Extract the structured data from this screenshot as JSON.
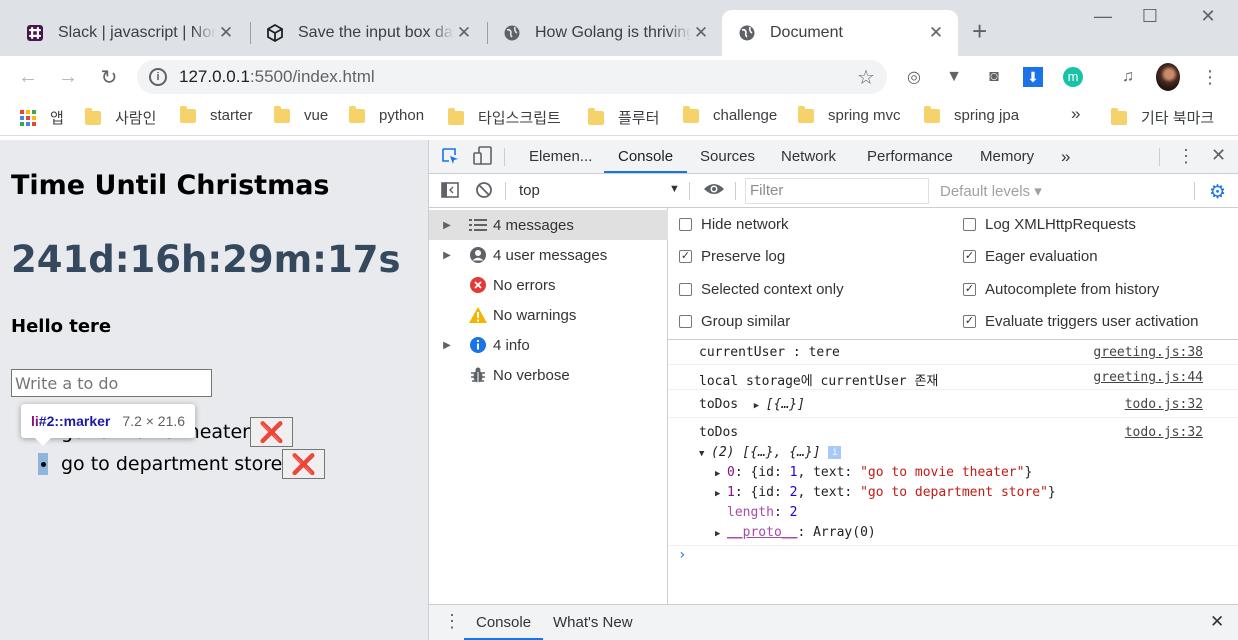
{
  "browser": {
    "tabs": [
      {
        "title": "Slack | javascript | Nom",
        "icon": "slack-icon"
      },
      {
        "title": "Save the input box data",
        "icon": "codesandbox-icon"
      },
      {
        "title": "How Golang is thriving",
        "icon": "globe-icon"
      },
      {
        "title": "Document",
        "icon": "globe-icon"
      }
    ],
    "url_host": "127.0.0.1",
    "url_path": ":5500/index.html",
    "bookmarks": [
      {
        "label": "앱",
        "icon": "apps-icon"
      },
      {
        "label": "사람인",
        "icon": "folder-icon"
      },
      {
        "label": "starter",
        "icon": "folder-icon"
      },
      {
        "label": "vue",
        "icon": "folder-icon"
      },
      {
        "label": "python",
        "icon": "folder-icon"
      },
      {
        "label": "타입스크립트",
        "icon": "folder-icon"
      },
      {
        "label": "플루터",
        "icon": "folder-icon"
      },
      {
        "label": "challenge",
        "icon": "folder-icon"
      },
      {
        "label": "spring mvc",
        "icon": "folder-icon"
      },
      {
        "label": "spring jpa",
        "icon": "folder-icon"
      }
    ],
    "bookmarks_overflow": "»",
    "other_bookmarks": "기타 북마크",
    "extension_badge": "m"
  },
  "page": {
    "title": "Time Until Christmas",
    "timer": "241d:16h:29m:17s",
    "greeting": "Hello tere",
    "todo_placeholder": "Write a to do",
    "todos": [
      {
        "text": "go to movie theater",
        "delete_label": "❌"
      },
      {
        "text": "go to department store",
        "delete_label": "❌"
      }
    ],
    "inspect_tooltip": {
      "selector_tag": "li",
      "selector_rest": "#2::marker",
      "dimensions": "7.2 × 21.6"
    }
  },
  "devtools": {
    "tabs": [
      "Elemen...",
      "Console",
      "Sources",
      "Network",
      "Performance",
      "Memory"
    ],
    "active_tab": "Console",
    "more_tabs": "»",
    "context": "top",
    "filter_placeholder": "Filter",
    "levels": "Default levels ▾",
    "sidebar": [
      {
        "label": "4 messages",
        "icon": "list-icon",
        "expandable": true,
        "selected": true
      },
      {
        "label": "4 user messages",
        "icon": "user-icon",
        "expandable": true,
        "selected": false
      },
      {
        "label": "No errors",
        "icon": "error-icon",
        "expandable": false,
        "selected": false
      },
      {
        "label": "No warnings",
        "icon": "warning-icon",
        "expandable": false,
        "selected": false
      },
      {
        "label": "4 info",
        "icon": "info-icon",
        "expandable": true,
        "selected": false
      },
      {
        "label": "No verbose",
        "icon": "bug-icon",
        "expandable": false,
        "selected": false
      }
    ],
    "settings": [
      {
        "label": "Hide network",
        "checked": false
      },
      {
        "label": "Log XMLHttpRequests",
        "checked": false
      },
      {
        "label": "Preserve log",
        "checked": true
      },
      {
        "label": "Eager evaluation",
        "checked": true
      },
      {
        "label": "Selected context only",
        "checked": false
      },
      {
        "label": "Autocomplete from history",
        "checked": true
      },
      {
        "label": "Group similar",
        "checked": false
      },
      {
        "label": "Evaluate triggers user activation",
        "checked": true
      }
    ],
    "console": {
      "logs": [
        {
          "text": "currentUser :  tere",
          "source": "greeting.js:38"
        },
        {
          "text": "local storage에 currentUser 존재",
          "source": "greeting.js:44"
        },
        {
          "label": "toDos",
          "preview": "[{…}]",
          "source": "todo.js:32"
        },
        {
          "label": "toDos",
          "summary": "(2) [{…}, {…}]",
          "source": "todo.js:32"
        }
      ],
      "expanded": {
        "item0_key": "0",
        "item0_id": "1",
        "item0_text": "\"go to movie theater\"",
        "item1_key": "1",
        "item1_id": "2",
        "item1_text": "\"go to department store\"",
        "length_key": "length",
        "length_val": "2",
        "proto_key": "__proto__",
        "proto_val": "Array(0)"
      }
    },
    "drawer_tabs": [
      "Console",
      "What's New"
    ]
  }
}
